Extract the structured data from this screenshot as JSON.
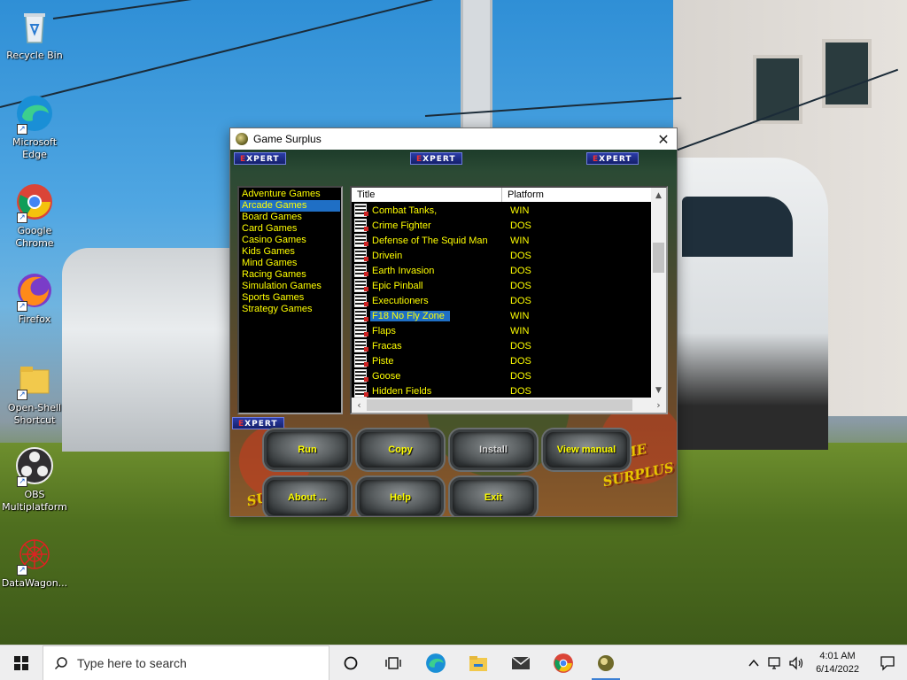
{
  "desktop": {
    "icons": [
      {
        "label": "Recycle Bin",
        "icon": "recycle-bin-icon"
      },
      {
        "label": "Microsoft Edge",
        "icon": "edge-icon"
      },
      {
        "label": "Google Chrome",
        "icon": "chrome-icon"
      },
      {
        "label": "Firefox",
        "icon": "firefox-icon"
      },
      {
        "label": "Open-Shell Shortcut",
        "icon": "folder-shortcut-icon"
      },
      {
        "label": "OBS Multiplatform",
        "icon": "obs-icon"
      },
      {
        "label": "DataWagon...",
        "icon": "datawagon-icon"
      }
    ]
  },
  "window": {
    "title": "Game Surplus",
    "close_glyph": "✕",
    "badge_text_prefix": "E",
    "badge_text_rest": "XPERT",
    "logo_line1": "GAME",
    "logo_line2": "SURPLUS",
    "categories": [
      "Adventure Games",
      "Arcade Games",
      "Board Games",
      "Card Games",
      "Casino Games",
      "Kids Games",
      "Mind Games",
      "Racing Games",
      "Simulation Games",
      "Sports Games",
      "Strategy Games"
    ],
    "selected_category": "Arcade Games",
    "columns": {
      "title": "Title",
      "platform": "Platform"
    },
    "games": [
      {
        "title": "Combat Tanks,",
        "platform": "WIN"
      },
      {
        "title": "Crime Fighter",
        "platform": "DOS"
      },
      {
        "title": "Defense of The Squid Man",
        "platform": "WIN"
      },
      {
        "title": "Drivein",
        "platform": "DOS"
      },
      {
        "title": "Earth Invasion",
        "platform": "DOS"
      },
      {
        "title": "Epic Pinball",
        "platform": "DOS"
      },
      {
        "title": "Executioners",
        "platform": "DOS"
      },
      {
        "title": "F18 No Fly Zone",
        "platform": "WIN"
      },
      {
        "title": "Flaps",
        "platform": "WIN"
      },
      {
        "title": "Fracas",
        "platform": "DOS"
      },
      {
        "title": "Piste",
        "platform": "DOS"
      },
      {
        "title": "Goose",
        "platform": "DOS"
      },
      {
        "title": "Hidden Fields",
        "platform": "DOS"
      }
    ],
    "selected_game": "F18 No Fly Zone",
    "buttons": {
      "run": "Run",
      "copy": "Copy",
      "install": "Install",
      "view_manual": "View manual",
      "about": "About ...",
      "help": "Help",
      "exit": "Exit"
    }
  },
  "taskbar": {
    "search_placeholder": "Type here to search",
    "time": "4:01 AM",
    "date": "6/14/2022",
    "apps": [
      "task-view-icon",
      "edge-icon",
      "file-explorer-icon",
      "mail-icon",
      "chrome-icon",
      "game-surplus-icon"
    ]
  },
  "colors": {
    "list_text": "#ffff00",
    "selection": "#1f6fc5",
    "list_background": "#000000"
  }
}
